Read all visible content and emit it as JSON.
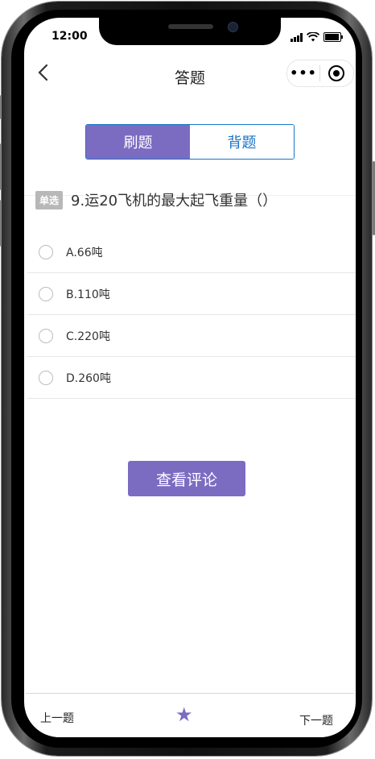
{
  "status_bar": {
    "time": "12:00"
  },
  "nav": {
    "title": "答题",
    "more_label": "•••"
  },
  "segments": {
    "active": "刷题",
    "inactive": "背题"
  },
  "question": {
    "type_badge": "单选",
    "text": "9.运20飞机的最大起飞重量（）"
  },
  "options": [
    {
      "label": "A.66吨"
    },
    {
      "label": "B.110吨"
    },
    {
      "label": "C.220吨"
    },
    {
      "label": "D.260吨"
    }
  ],
  "review_button": "查看评论",
  "bottom": {
    "prev": "上一题",
    "next": "下一题",
    "favorite_icon": "star-icon"
  },
  "colors": {
    "accent": "#7b6cc2",
    "link_blue": "#1a73c8"
  }
}
